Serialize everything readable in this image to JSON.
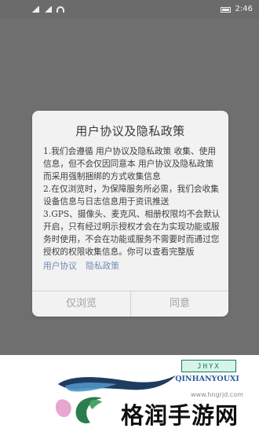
{
  "status_bar": {
    "time": "2:46"
  },
  "dialog": {
    "title": "用户协议及隐私政策",
    "body": [
      "1.我们会遵循 用户协议及隐私政策 收集、使用信息，但不会仅因同意本 用户协议及隐私政策 而采用强制捆绑的方式收集信息",
      "2.在仅浏览时，为保障服务所必需，我们会收集设备信息与日志信息用于资讯推送",
      "3.GPS、摄像头、麦克风、相册权限均不会默认开启，只有经过明示授权才会在为实现功能或服务时使用，不会在功能或服务不需要时而通过您授权的权限收集信息。你可以查看完整版"
    ],
    "links": [
      "用户协议",
      "隐私政策"
    ],
    "buttons": {
      "browse": "仅浏览",
      "agree": "同意"
    }
  },
  "watermark": {
    "badge": "JHYX",
    "brand": "QINHANYOUXI",
    "url": "www.hngrjd.com",
    "site_name": "格润手游网"
  },
  "colors": {
    "overlay": "#6f6f6f",
    "dialog": "#f2f2f2",
    "link": "#6f8ab0",
    "button": "#a2a2a2",
    "watermark_dark": "#1e3a5f",
    "watermark_green": "#2c7d4e",
    "watermark_pink": "#e7a7cf"
  }
}
